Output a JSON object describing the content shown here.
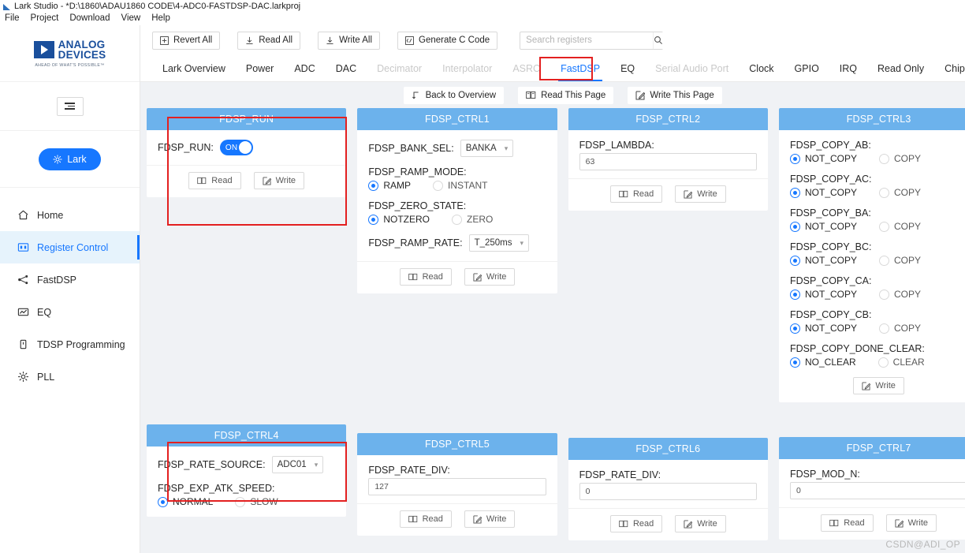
{
  "window": {
    "title": "Lark Studio - *D:\\1860\\ADAU1860 CODE\\4-ADC0-FASTDSP-DAC.larkproj",
    "menu": [
      "File",
      "Project",
      "Download",
      "View",
      "Help"
    ]
  },
  "sidebar": {
    "brand_line1": "ANALOG",
    "brand_line2": "DEVICES",
    "brand_tagline": "AHEAD OF WHAT'S POSSIBLE™",
    "device_button": "Lark",
    "items": [
      {
        "label": "Home",
        "icon": "home-icon",
        "active": false
      },
      {
        "label": "Register Control",
        "icon": "register-icon",
        "active": true
      },
      {
        "label": "FastDSP",
        "icon": "share-nodes-icon",
        "active": false
      },
      {
        "label": "EQ",
        "icon": "chart-icon",
        "active": false
      },
      {
        "label": "TDSP Programming",
        "icon": "chip-icon",
        "active": false
      },
      {
        "label": "PLL",
        "icon": "gear-icon",
        "active": false
      }
    ]
  },
  "toolbar": {
    "revert_all": "Revert All",
    "read_all": "Read All",
    "write_all": "Write All",
    "generate_c_code": "Generate C Code",
    "search_placeholder": "Search registers",
    "search_value": ""
  },
  "tabs": [
    {
      "label": "Lark Overview",
      "state": "normal"
    },
    {
      "label": "Power",
      "state": "normal"
    },
    {
      "label": "ADC",
      "state": "normal"
    },
    {
      "label": "DAC",
      "state": "normal"
    },
    {
      "label": "Decimator",
      "state": "disabled"
    },
    {
      "label": "Interpolator",
      "state": "disabled"
    },
    {
      "label": "ASRC",
      "state": "disabled"
    },
    {
      "label": "FastDSP",
      "state": "active"
    },
    {
      "label": "EQ",
      "state": "normal"
    },
    {
      "label": "Serial Audio Port",
      "state": "disabled"
    },
    {
      "label": "Clock",
      "state": "normal"
    },
    {
      "label": "GPIO",
      "state": "normal"
    },
    {
      "label": "IRQ",
      "state": "normal"
    },
    {
      "label": "Read Only",
      "state": "normal"
    },
    {
      "label": "ChipID",
      "state": "normal"
    }
  ],
  "page_actions": {
    "back_to_overview": "Back to Overview",
    "read_this_page": "Read This Page",
    "write_this_page": "Write This Page"
  },
  "buttons": {
    "read": "Read",
    "write": "Write"
  },
  "cards": {
    "fdsp_run": {
      "title": "FDSP_RUN",
      "field_label": "FDSP_RUN:",
      "toggle_value": "ON"
    },
    "fdsp_ctrl1": {
      "title": "FDSP_CTRL1",
      "bank_sel_label": "FDSP_BANK_SEL:",
      "bank_sel_value": "BANKA",
      "ramp_mode_label": "FDSP_RAMP_MODE:",
      "ramp_mode_options": [
        "RAMP",
        "INSTANT"
      ],
      "ramp_mode_selected": "RAMP",
      "zero_state_label": "FDSP_ZERO_STATE:",
      "zero_state_options": [
        "NOTZERO",
        "ZERO"
      ],
      "zero_state_selected": "NOTZERO",
      "ramp_rate_label": "FDSP_RAMP_RATE:",
      "ramp_rate_value": "T_250ms"
    },
    "fdsp_ctrl2": {
      "title": "FDSP_CTRL2",
      "lambda_label": "FDSP_LAMBDA:",
      "lambda_value": "63"
    },
    "fdsp_ctrl3": {
      "title": "FDSP_CTRL3",
      "groups": [
        {
          "label": "FDSP_COPY_AB:",
          "options": [
            "NOT_COPY",
            "COPY"
          ],
          "selected": "NOT_COPY"
        },
        {
          "label": "FDSP_COPY_AC:",
          "options": [
            "NOT_COPY",
            "COPY"
          ],
          "selected": "NOT_COPY"
        },
        {
          "label": "FDSP_COPY_BA:",
          "options": [
            "NOT_COPY",
            "COPY"
          ],
          "selected": "NOT_COPY"
        },
        {
          "label": "FDSP_COPY_BC:",
          "options": [
            "NOT_COPY",
            "COPY"
          ],
          "selected": "NOT_COPY"
        },
        {
          "label": "FDSP_COPY_CA:",
          "options": [
            "NOT_COPY",
            "COPY"
          ],
          "selected": "NOT_COPY"
        },
        {
          "label": "FDSP_COPY_CB:",
          "options": [
            "NOT_COPY",
            "COPY"
          ],
          "selected": "NOT_COPY"
        },
        {
          "label": "FDSP_COPY_DONE_CLEAR:",
          "options": [
            "NO_CLEAR",
            "CLEAR"
          ],
          "selected": "NO_CLEAR"
        }
      ]
    },
    "fdsp_ctrl4": {
      "title": "FDSP_CTRL4",
      "rate_source_label": "FDSP_RATE_SOURCE:",
      "rate_source_value": "ADC01",
      "exp_atk_label": "FDSP_EXP_ATK_SPEED:",
      "exp_atk_options": [
        "NORMAL",
        "SLOW"
      ],
      "exp_atk_selected": "NORMAL"
    },
    "fdsp_ctrl5": {
      "title": "FDSP_CTRL5",
      "rate_div_label": "FDSP_RATE_DIV:",
      "rate_div_value": "127"
    },
    "fdsp_ctrl6": {
      "title": "FDSP_CTRL6",
      "rate_div_label": "FDSP_RATE_DIV:",
      "rate_div_value": "0"
    },
    "fdsp_ctrl7": {
      "title": "FDSP_CTRL7",
      "mod_n_label": "FDSP_MOD_N:",
      "mod_n_value": "0"
    }
  },
  "watermark": "CSDN@ADI_OP",
  "colors": {
    "accent": "#1677ff",
    "card_header": "#6cb2ec",
    "annotation": "#e32020",
    "page_bg": "#f0f2f5"
  }
}
